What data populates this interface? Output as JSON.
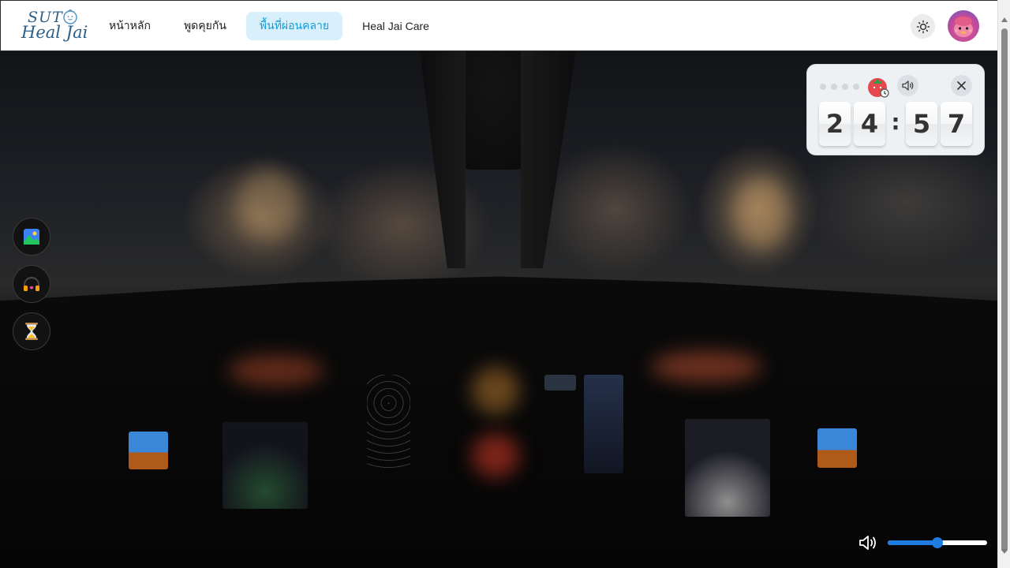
{
  "logo": {
    "line1": "SUT",
    "line2": "Heal Jai"
  },
  "nav": {
    "items": [
      {
        "label": "หน้าหลัก",
        "active": false
      },
      {
        "label": "พูดคุยกัน",
        "active": false
      },
      {
        "label": "พื้นที่ผ่อนคลาย",
        "active": true
      },
      {
        "label": "Heal Jai Care",
        "active": false
      }
    ]
  },
  "header": {
    "theme_icon": "sun-icon",
    "avatar_icon": "avatar"
  },
  "tools": [
    {
      "name": "background-image-button",
      "icon": "image-icon"
    },
    {
      "name": "music-button",
      "icon": "headphones-icon"
    },
    {
      "name": "timer-button",
      "icon": "hourglass-icon"
    }
  ],
  "timer": {
    "digits": [
      "2",
      "4",
      "5",
      "7"
    ],
    "separator": ":",
    "session_dots": 4,
    "icon": "tomato-timer-icon",
    "sound_icon": "speaker-icon",
    "close_icon": "close-icon"
  },
  "volume": {
    "icon": "volume-icon",
    "level": 0.5
  },
  "colors": {
    "active_tab_bg": "#d7f0fb",
    "active_tab_text": "#1a9ad6",
    "slider": "#1e7be0",
    "timer_card_bg": "#eef1f4"
  }
}
